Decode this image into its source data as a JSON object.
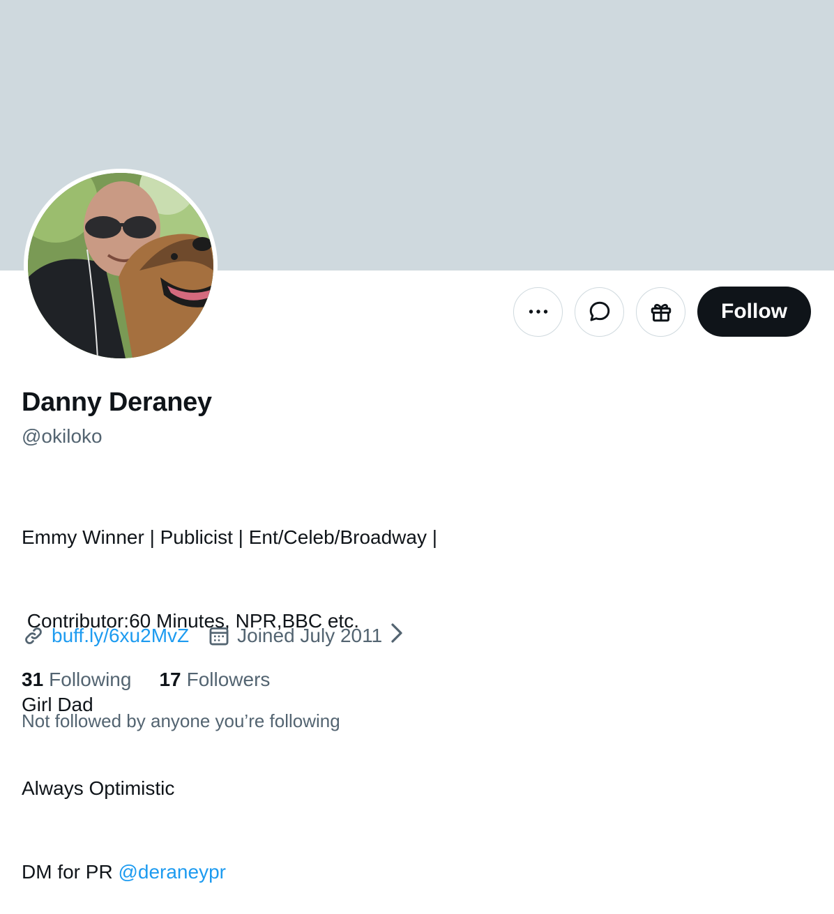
{
  "profile": {
    "display_name": "Danny Deraney",
    "handle": "@okiloko",
    "bio_lines": [
      "Emmy Winner | Publicist | Ent/Celeb/Broadway |",
      " Contributor:60 Minutes, NPR,BBC etc.",
      "Girl Dad",
      "Always Optimistic"
    ],
    "bio_last_prefix": "DM for PR ",
    "bio_last_mention": "@deraneypr",
    "website": "buff.ly/6xu2MvZ",
    "joined": "Joined July 2011",
    "following_count": "31",
    "following_label": "Following",
    "followers_count": "17",
    "followers_label": "Followers",
    "followed_by_note": "Not followed by anyone you’re following"
  },
  "actions": {
    "more_icon": "more-icon",
    "message_icon": "message-icon",
    "gift_icon": "gift-icon",
    "follow_label": "Follow"
  },
  "colors": {
    "banner": "#cfd9de",
    "primary_text": "#0f1419",
    "secondary_text": "#536471",
    "link": "#1d9bf0",
    "follow_button_bg": "#0f1419"
  }
}
